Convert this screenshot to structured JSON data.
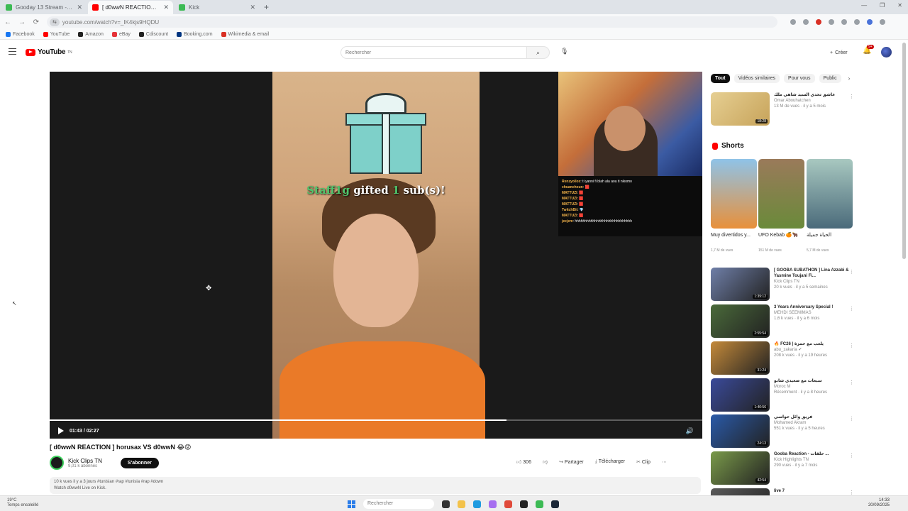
{
  "browser": {
    "tabs": [
      {
        "title": "Gooday 13 Stream - Watch H...",
        "color": "#3cba54",
        "active": false
      },
      {
        "title": "[ d0wwN REACTION ] ho...",
        "color": "#ff0000",
        "active": true
      },
      {
        "title": "Kick",
        "color": "#3cba54",
        "active": false
      }
    ],
    "url": "youtube.com/watch?v=_IK4kjs9HQDU",
    "bookmarks": [
      "Facebook",
      "YouTube",
      "Amazon",
      "eBay",
      "Cdiscount",
      "Booking.com",
      "Wikimedia & email"
    ]
  },
  "yt": {
    "logo": "YouTube",
    "logo_sup": "TN",
    "search_placeholder": "Rechercher",
    "create_label": "Créer",
    "notif_count": "9+"
  },
  "video": {
    "gift_user": "Staff1g",
    "gift_mid": " gifted ",
    "gift_num": "1",
    "gift_end": " sub(s)!",
    "time": "01:43 / 02:27",
    "progress": 0.7,
    "chat": [
      {
        "user": "Renzyollox",
        "msg": ": ti yanni fi blah ala aou ti nikomo"
      },
      {
        "user": "chuanchoun",
        "msg": ": 🟥"
      },
      {
        "user": "MATTUZI",
        "msg": ": 🟥"
      },
      {
        "user": "MATTUZI",
        "msg": ": 🟥"
      },
      {
        "user": "MATTUZI",
        "msg": ": 🟥"
      },
      {
        "user": "TwitchBit",
        "msg": ": 💎"
      },
      {
        "user": "MATTUZI",
        "msg": ": 🟥"
      },
      {
        "user": "jeejem",
        "msg": ": hhhhhhhhhhhhhhhhhhhhhhhhhhhhh"
      }
    ],
    "title": "[ d0wwN REACTION ] horusax VS d0wwN 😂😡",
    "channel": "Kick Clips TN",
    "subs": "9,01 k abonnés",
    "subscribe": "S'abonner",
    "likes": "306",
    "share": "Partager",
    "download": "Télécharger",
    "clip": "Clip",
    "desc_line1": "10 k vues  il y a 3 jours  #tunisian #rap #tunisia #rap #down",
    "desc_line2": "Watch d0wwN Live on Kick."
  },
  "sidebar": {
    "chips": [
      "Tout",
      "Vidéos similaires",
      "Pour vous",
      "Public"
    ],
    "top_rec": {
      "title": "عاشق تحدي السيد شاهي ملك",
      "channel": "Omar Abouhatchen",
      "views": "13 M de vues · il y a 5 mois",
      "duration": "18:28",
      "color": "#d9b66a"
    },
    "shorts_title": "Shorts",
    "shorts": [
      {
        "label": "Muy divertidos y...",
        "views": "1,7 M de vues",
        "color": "#7fb1d8"
      },
      {
        "label": "UFO Kebab 🍊🐂",
        "views": "151 M de vues",
        "color": "#8a6a4a"
      },
      {
        "label": "الحياة جميلة",
        "views": "5,7 M de vues",
        "color": "#6ea7a0"
      }
    ],
    "recs": [
      {
        "title": "[ GOOBA SUBATHON ] Lina Azzabi & Yasmine Toujani Fi...",
        "channel": "Kick Clips TN",
        "views": "20 k vues · il y a 5 semaines",
        "duration": "1:39:12",
        "color": "#6f7fa8"
      },
      {
        "title": "3 Years Anniversary Special !",
        "channel": "MEHDI SEEMIMAS",
        "views": "1,6 k vues · il y a 6 mois",
        "duration": "2:55:54",
        "color": "#4a6a3a"
      },
      {
        "title": "🔥 FC26 | يلعب مع حمزة",
        "channel": "abu_zakaria ✔",
        "views": "208 k vues · il y a 19 heures",
        "duration": "31:24",
        "color": "#c48a3a"
      },
      {
        "title": "سبعات مع صعيدي شابو",
        "channel": "Moroc M",
        "views": "Récemment · il y a 8 heures",
        "duration": "1:40:56",
        "color": "#3a4a9a"
      },
      {
        "title": "فريق وائل حواسي",
        "channel": "Mohamed Akram",
        "views": "551 k vues · il y a 5 heures",
        "duration": "24:13",
        "color": "#2a5aa8"
      },
      {
        "title": "Gooba Reaction - حلقات ...",
        "channel": "Kick Highlights TN",
        "views": "290 vues · il y a 7 mois",
        "duration": "42:54",
        "color": "#7a9a4a"
      },
      {
        "title": "live 7",
        "channel": "",
        "views": "",
        "duration": "",
        "color": "#5a5a5a"
      }
    ]
  },
  "taskbar": {
    "weather_temp": "19°C",
    "weather_desc": "Temps ensoleillé",
    "search": "Rechercher",
    "time": "14:33",
    "date": "20/09/2025"
  }
}
